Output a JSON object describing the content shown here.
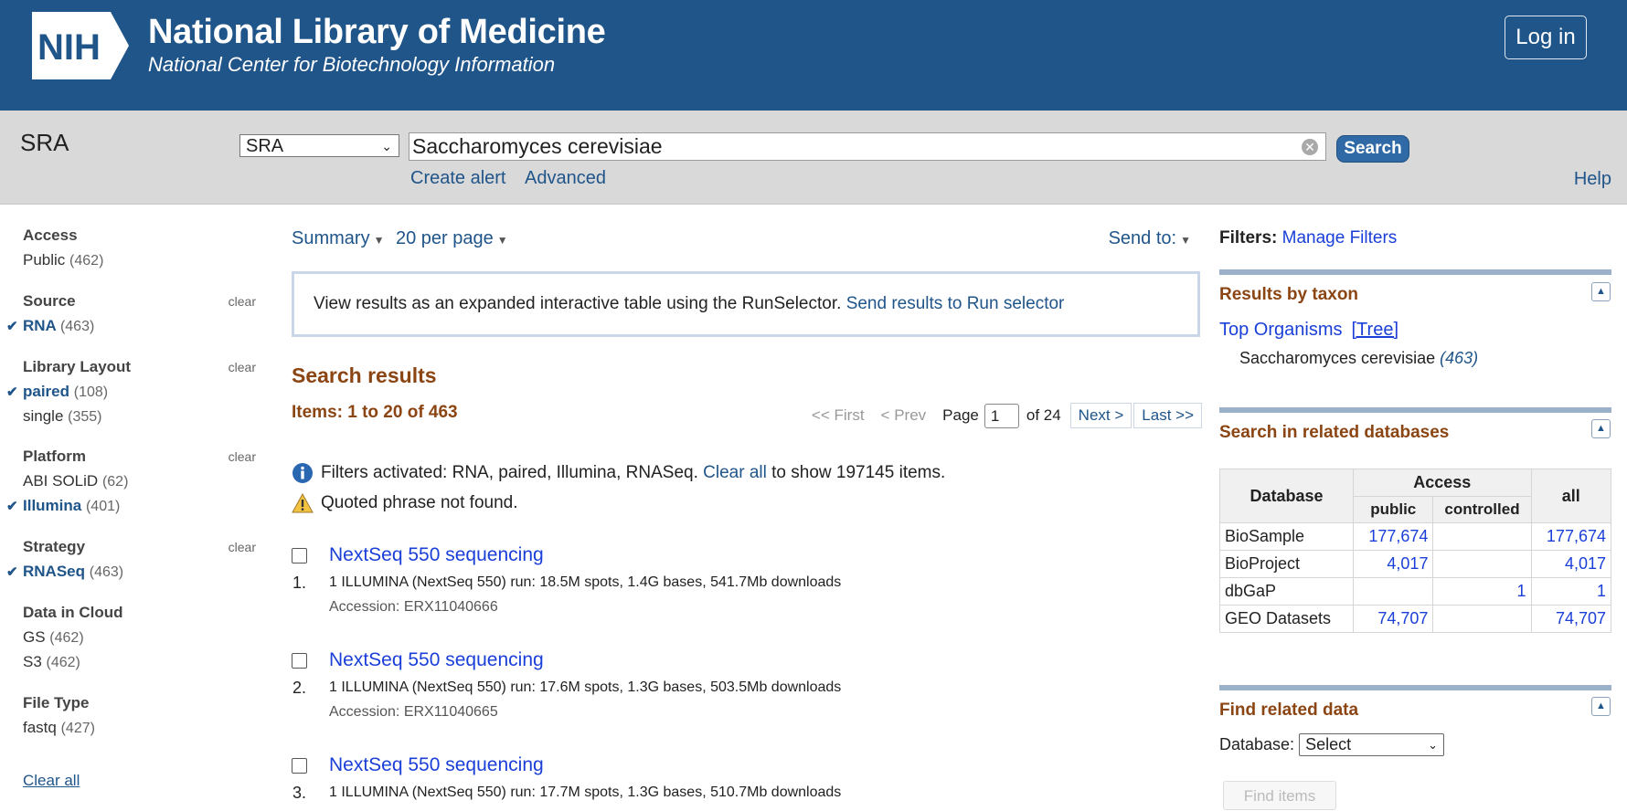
{
  "header": {
    "logo_text": "NIH",
    "title": "National Library of Medicine",
    "subtitle": "National Center for Biotechnology Information",
    "login_label": "Log in"
  },
  "search": {
    "db_name": "SRA",
    "db_selected": "SRA",
    "query": "Saccharomyces cerevisiae",
    "button_label": "Search",
    "create_alert": "Create alert",
    "advanced": "Advanced",
    "help": "Help"
  },
  "facets": [
    {
      "title": "Access",
      "clear": "",
      "items": [
        {
          "label": "Public",
          "count": "(462)",
          "selected": false
        }
      ]
    },
    {
      "title": "Source",
      "clear": "clear",
      "items": [
        {
          "label": "RNA",
          "count": "(463)",
          "selected": true
        }
      ]
    },
    {
      "title": "Library Layout",
      "clear": "clear",
      "items": [
        {
          "label": "paired",
          "count": "(108)",
          "selected": true
        },
        {
          "label": "single",
          "count": "(355)",
          "selected": false
        }
      ]
    },
    {
      "title": "Platform",
      "clear": "clear",
      "items": [
        {
          "label": "ABI SOLiD",
          "count": "(62)",
          "selected": false
        },
        {
          "label": "Illumina",
          "count": "(401)",
          "selected": true
        }
      ]
    },
    {
      "title": "Strategy",
      "clear": "clear",
      "items": [
        {
          "label": "RNASeq",
          "count": "(463)",
          "selected": true
        }
      ]
    },
    {
      "title": "Data in Cloud",
      "clear": "",
      "items": [
        {
          "label": "GS",
          "count": "(462)",
          "selected": false
        },
        {
          "label": "S3",
          "count": "(462)",
          "selected": false
        }
      ]
    },
    {
      "title": "File Type",
      "clear": "",
      "items": [
        {
          "label": "fastq",
          "count": "(427)",
          "selected": false
        }
      ]
    }
  ],
  "left_clear_all": "Clear all",
  "controls": {
    "format": "Summary",
    "per_page": "20 per page",
    "send_to": "Send to:"
  },
  "runselector": {
    "text": "View results as an expanded interactive table using the RunSelector.",
    "link": "Send results to Run selector"
  },
  "results_header": {
    "title": "Search results",
    "items": "Items: 1 to 20 of 463"
  },
  "pager": {
    "first": "<< First",
    "prev": "< Prev",
    "page_label": "Page",
    "page_value": "1",
    "of": "of 24",
    "next": "Next >",
    "last": "Last >>"
  },
  "notices": {
    "filters_text": "Filters activated: RNA, paired, Illumina, RNASeq.",
    "clear_all": "Clear all",
    "filters_tail": "to show 197145 items.",
    "quoted": "Quoted phrase not found."
  },
  "results": [
    {
      "num": "1.",
      "title": "NextSeq 550 sequencing",
      "desc": "1 ILLUMINA (NextSeq 550) run: 18.5M spots, 1.4G bases, 541.7Mb downloads",
      "accession": "Accession: ERX11040666"
    },
    {
      "num": "2.",
      "title": "NextSeq 550 sequencing",
      "desc": "1 ILLUMINA (NextSeq 550) run: 17.6M spots, 1.3G bases, 503.5Mb downloads",
      "accession": "Accession: ERX11040665"
    },
    {
      "num": "3.",
      "title": "NextSeq 550 sequencing",
      "desc": "1 ILLUMINA (NextSeq 550) run: 17.7M spots, 1.3G bases, 510.7Mb downloads",
      "accession": ""
    }
  ],
  "right": {
    "filters_label": "Filters:",
    "manage_filters": "Manage Filters",
    "taxon_title": "Results by taxon",
    "top_organisms": "Top Organisms",
    "tree": "[Tree]",
    "organism": "Saccharomyces cerevisiae",
    "organism_count": "(463)",
    "related_title": "Search in related databases",
    "table_headers": {
      "database": "Database",
      "access": "Access",
      "public": "public",
      "controlled": "controlled",
      "all": "all"
    },
    "table_rows": [
      {
        "db": "BioSample",
        "public": "177,674",
        "controlled": "",
        "all": "177,674"
      },
      {
        "db": "BioProject",
        "public": "4,017",
        "controlled": "",
        "all": "4,017"
      },
      {
        "db": "dbGaP",
        "public": "",
        "controlled": "1",
        "all": "1"
      },
      {
        "db": "GEO Datasets",
        "public": "74,707",
        "controlled": "",
        "all": "74,707"
      }
    ],
    "find_title": "Find related data",
    "database_label": "Database:",
    "database_select": "Select",
    "find_button": "Find items"
  }
}
